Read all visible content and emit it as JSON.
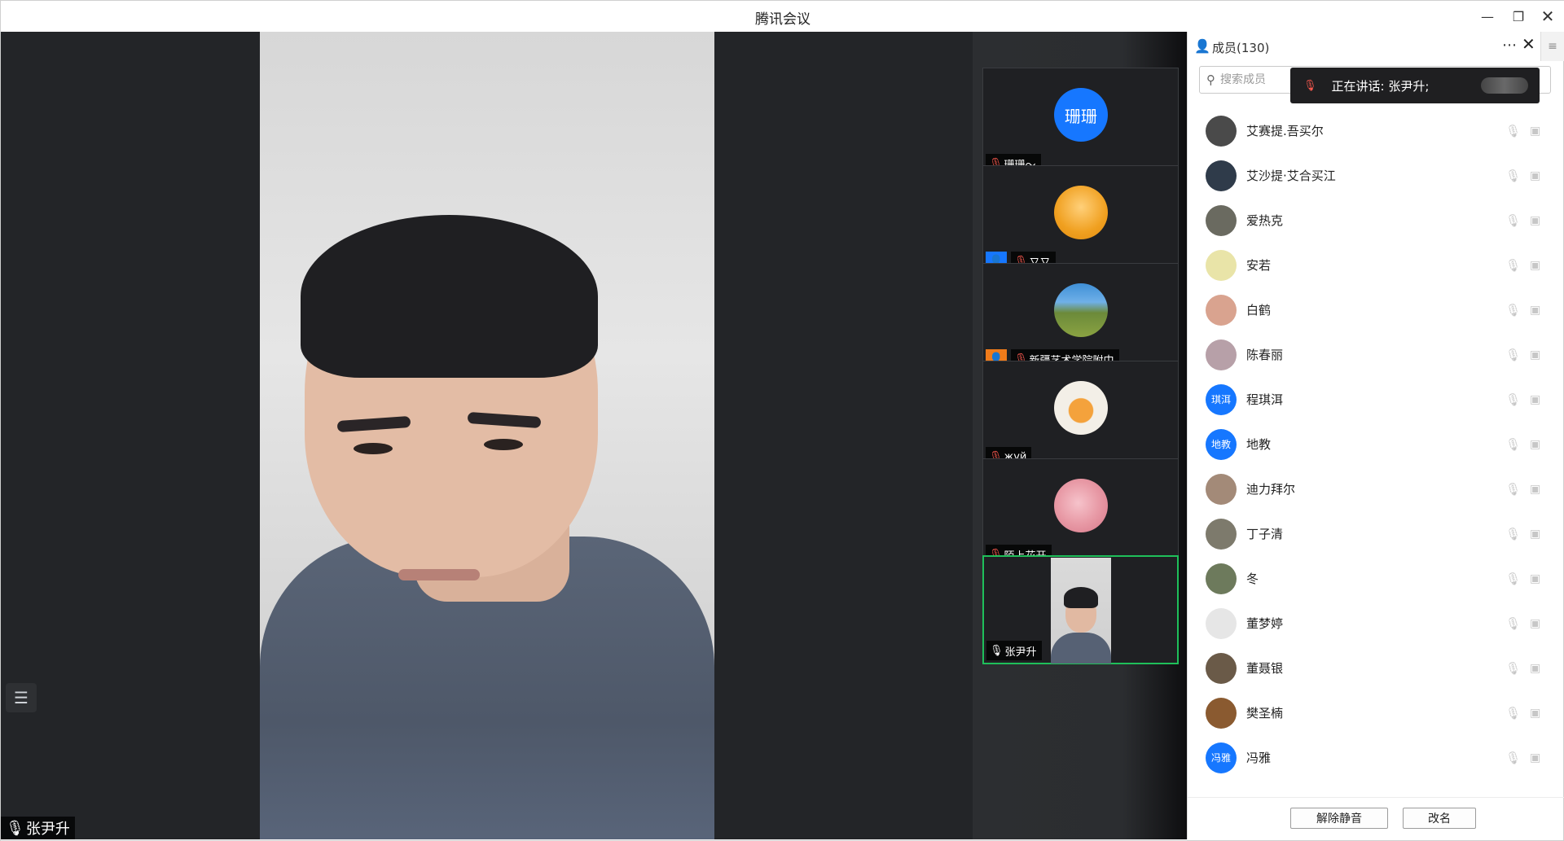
{
  "window": {
    "title": "腾讯会议"
  },
  "main_video": {
    "speaker_name": "张尹升"
  },
  "thumbnails": [
    {
      "name": "珊珊～",
      "avatar_text": "珊珊",
      "avatar_color": "#1677ff",
      "mic": "muted"
    },
    {
      "name": "又又",
      "avatar_color": "#f0a020",
      "mic": "muted",
      "badge": "user-blue"
    },
    {
      "name": "新疆艺术学院附中",
      "avatar_color": "#6c8a3a",
      "mic": "muted",
      "badge": "user-orange"
    },
    {
      "name": "жуй",
      "avatar_color": "#f3efe7",
      "mic": "muted"
    },
    {
      "name": "陌上花开",
      "avatar_color": "#e89aa6",
      "mic": "muted"
    },
    {
      "name": "张尹升",
      "mic": "on",
      "active": true
    }
  ],
  "panel": {
    "title": "成员(130)",
    "search_placeholder": "搜索成员",
    "speaking_toast": "正在讲话: 张尹升;",
    "members": [
      {
        "name": "艾赛提.吾买尔",
        "avatar_color": "#4a4a4a"
      },
      {
        "name": "艾沙提·艾合买江",
        "avatar_color": "#2f3b4a"
      },
      {
        "name": "爱热克",
        "avatar_color": "#6a6a60"
      },
      {
        "name": "安若",
        "avatar_color": "#e9e4a8"
      },
      {
        "name": "白鹤",
        "avatar_color": "#d9a38f"
      },
      {
        "name": "陈春丽",
        "avatar_color": "#b7a0a8"
      },
      {
        "name": "程琪洱",
        "avatar_text": "琪洱",
        "avatar_color": "#1677ff"
      },
      {
        "name": "地教",
        "avatar_text": "地教",
        "avatar_color": "#1677ff"
      },
      {
        "name": "迪力拜尔",
        "avatar_color": "#a38a78"
      },
      {
        "name": "丁子清",
        "avatar_color": "#7d7a6c"
      },
      {
        "name": "冬",
        "avatar_color": "#6d7a5c"
      },
      {
        "name": "董梦婷",
        "avatar_color": "#e6e6e6"
      },
      {
        "name": "董聂银",
        "avatar_color": "#6a5a48"
      },
      {
        "name": "樊圣楠",
        "avatar_color": "#8a5a30"
      },
      {
        "name": "冯雅",
        "avatar_text": "冯雅",
        "avatar_color": "#1677ff"
      }
    ],
    "unmute_label": "解除静音",
    "rename_label": "改名"
  }
}
